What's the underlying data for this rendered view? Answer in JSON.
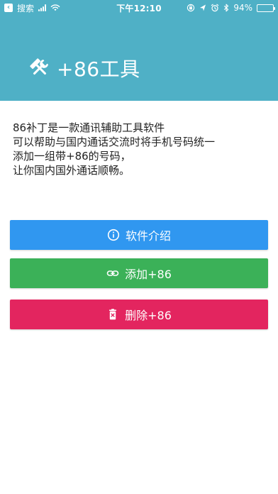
{
  "status_bar": {
    "back_label": "搜索",
    "time": "下午12:10",
    "battery": "94%",
    "battery_level": 0.94
  },
  "app": {
    "icon": "tools-icon",
    "title": "+86工具"
  },
  "description": {
    "lines": [
      "86补丁是一款通讯辅助工具软件",
      "可以帮助与国内通话交流时将手机号码统一",
      "添加一组带+86的号码，",
      "让你国内国外通话顺畅。"
    ]
  },
  "buttons": {
    "intro": {
      "label": "软件介绍",
      "icon": "info-icon",
      "color": "#3097f0"
    },
    "add": {
      "label": "添加+86",
      "icon": "link-icon",
      "color": "#3bb158"
    },
    "delete": {
      "label": "删除+86",
      "icon": "trash-icon",
      "color": "#e3255f"
    }
  },
  "colors": {
    "header": "#4fb0c6",
    "background": "#ffffff",
    "text": "#222222"
  }
}
